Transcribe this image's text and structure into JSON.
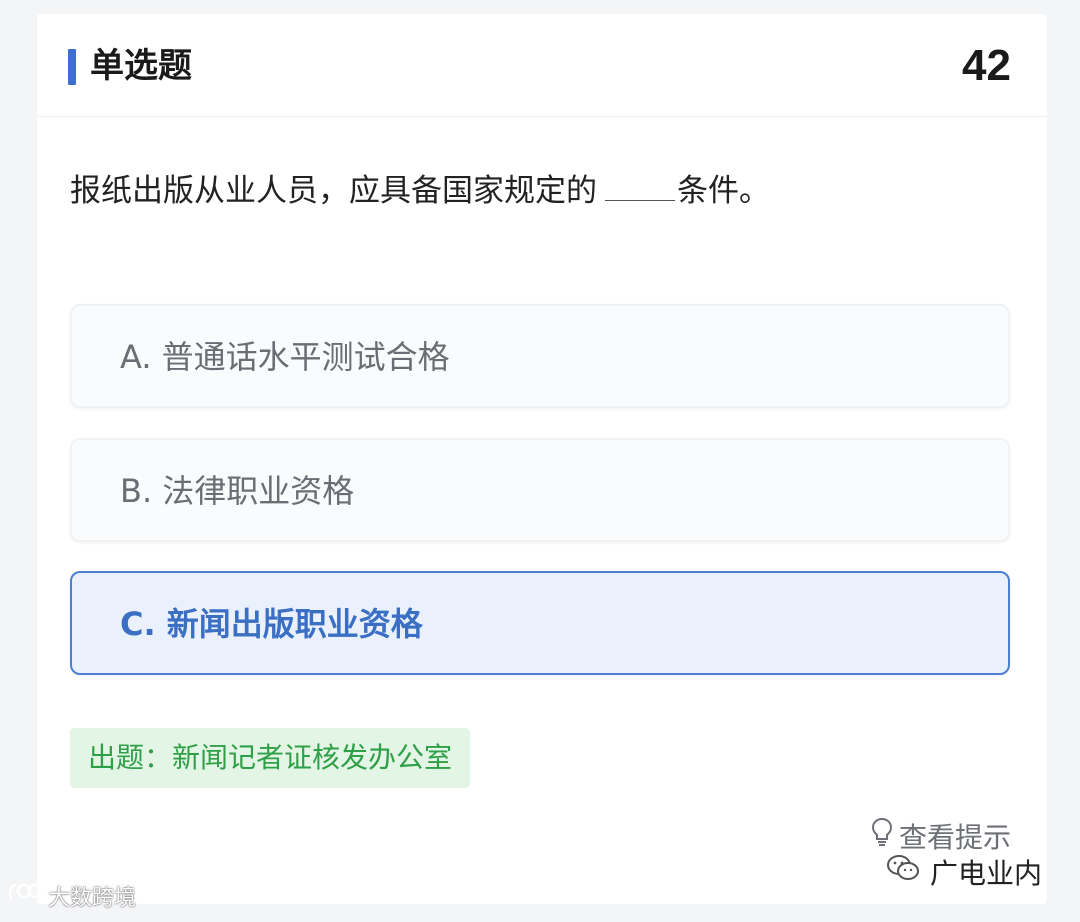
{
  "header": {
    "title": "单选题",
    "number": "42",
    "accent_color": "#3f6fd1"
  },
  "question": {
    "text_before": "报纸出版从业人员，应具备国家规定的",
    "text_after": "条件。"
  },
  "options": [
    {
      "label": "A. 普通话水平测试合格",
      "selected": false
    },
    {
      "label": "B. 法律职业资格",
      "selected": false
    },
    {
      "label": "C. 新闻出版职业资格",
      "selected": true
    }
  ],
  "source_badge": "出题：新闻记者证核发办公室",
  "hint": {
    "icon": "lightbulb-icon",
    "label": "查看提示"
  },
  "watermarks": {
    "left": "大数跨境",
    "right": "广电业内"
  },
  "colors": {
    "selected_border": "#4d7fd0",
    "selected_bg": "#eaf1fd",
    "selected_text": "#3a6fc3",
    "source_bg": "#e3f6e5",
    "source_text": "#2fa048"
  }
}
